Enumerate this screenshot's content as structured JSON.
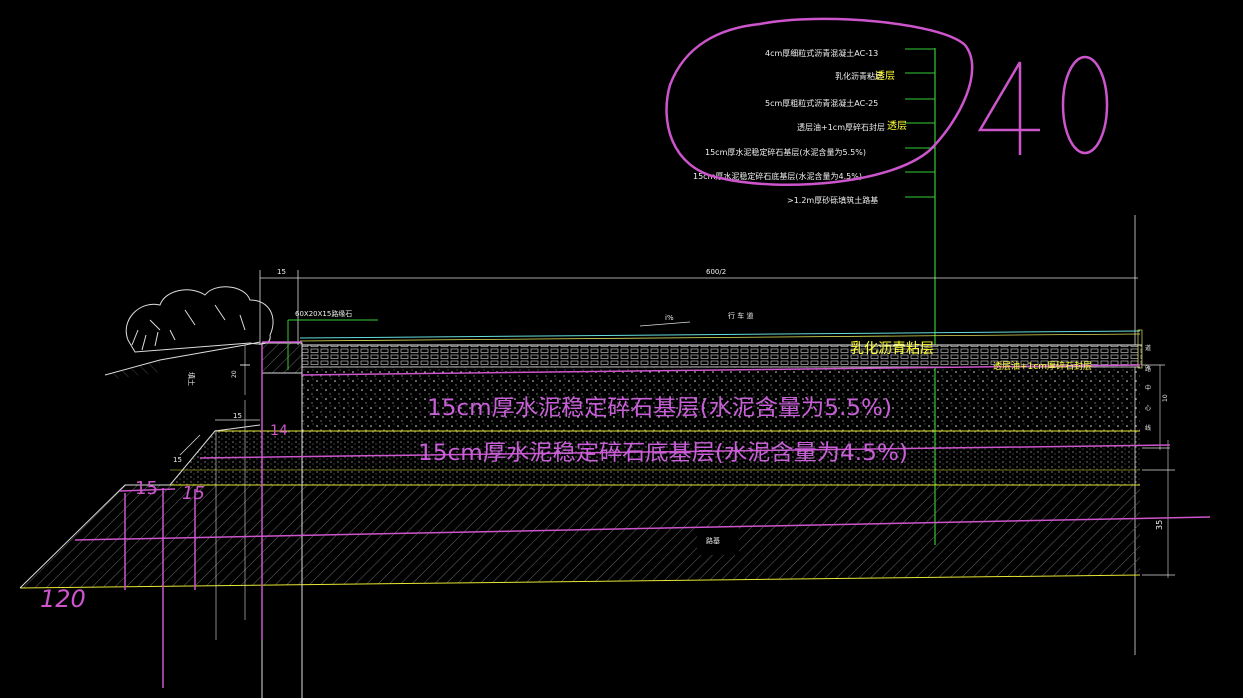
{
  "colors": {
    "background": "#000000",
    "line_white": "#e8e8e8",
    "line_green": "#33cc33",
    "line_yellow": "#e6e633",
    "line_magenta": "#cc55cc",
    "text_magenta": "#c85fd8",
    "text_yellow": "#ffff33",
    "text_white": "#f0f0f0",
    "hatch_gray": "#6a6a6a",
    "cyan_line": "#66dddd"
  },
  "legend": {
    "items": [
      {
        "text": "4cm厚细粒式沥青混凝土AC-13",
        "tag": ""
      },
      {
        "text": "乳化沥青粘层",
        "tag": "透层"
      },
      {
        "text": "5cm厚粗粒式沥青混凝土AC-25",
        "tag": ""
      },
      {
        "text": "透层油+1cm厚碎石封层",
        "tag": "透层"
      },
      {
        "text": "15cm厚水泥稳定碎石基层(水泥含量为5.5%)",
        "tag": ""
      },
      {
        "text": "15cm厚水泥稳定碎石底基层(水泥含量为4.5%)",
        "tag": ""
      },
      {
        "text": ">1.2m厚砂砾填筑土路基",
        "tag": ""
      }
    ]
  },
  "big_number": {
    "left": "4",
    "right": "0"
  },
  "dimensions": {
    "top_left": "15",
    "top_main": "600/2",
    "slope": "i%",
    "lane": "行 车 道",
    "curb": "60X20X15路缘石",
    "curb_height": "20",
    "step_width": "15",
    "step_left": "15",
    "right_a": "10",
    "right_b": "35"
  },
  "labels": {
    "left_soil": "填土",
    "road_bed": "路基",
    "emulsion": "乳化沥青粘层",
    "seal": "透层油+1cm厚碎石封层",
    "base": "15cm厚水泥稳定碎石基层(水泥含量为5.5%)",
    "subbase": "15cm厚水泥稳定碎石底基层(水泥含量为4.5%)",
    "hand_15a": "15",
    "hand_15b": "15",
    "hand_14": "14",
    "hand_120": "120"
  },
  "right_side_labels": [
    "道",
    "路",
    "中",
    "心",
    "线"
  ]
}
